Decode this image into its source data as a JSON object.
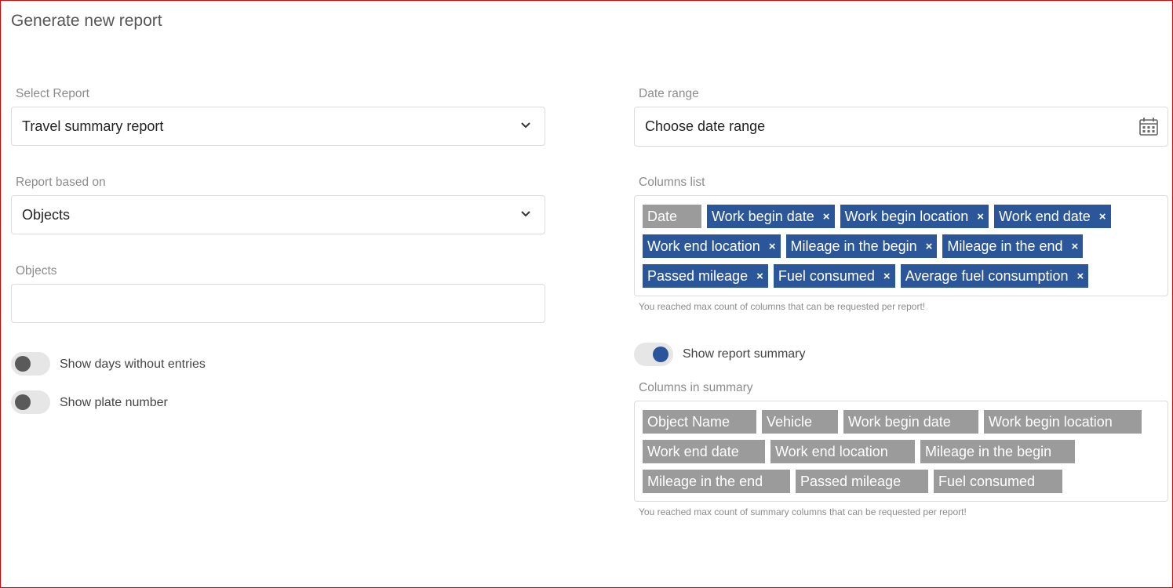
{
  "page_title": "Generate new report",
  "select_report": {
    "label": "Select Report",
    "value": "Travel summary report",
    "icon": "chevron-down-icon"
  },
  "report_based_on": {
    "label": "Report based on",
    "value": "Objects",
    "icon": "chevron-down-icon"
  },
  "objects": {
    "label": "Objects",
    "value": ""
  },
  "toggles": {
    "show_days_without_entries": {
      "label": "Show days without entries",
      "on": false
    },
    "show_plate_number": {
      "label": "Show plate number",
      "on": false
    },
    "show_report_summary": {
      "label": "Show report summary",
      "on": true
    }
  },
  "date_range": {
    "label": "Date range",
    "placeholder": "Choose date range",
    "icon": "calendar-icon"
  },
  "columns_list": {
    "label": "Columns list",
    "tags": [
      {
        "text": "Date",
        "removable": false
      },
      {
        "text": "Work begin date",
        "removable": true
      },
      {
        "text": "Work begin location",
        "removable": true
      },
      {
        "text": "Work end date",
        "removable": true
      },
      {
        "text": "Work end location",
        "removable": true
      },
      {
        "text": "Mileage in the begin",
        "removable": true
      },
      {
        "text": "Mileage in the end",
        "removable": true
      },
      {
        "text": "Passed mileage",
        "removable": true
      },
      {
        "text": "Fuel consumed",
        "removable": true
      },
      {
        "text": "Average fuel consumption",
        "removable": true
      }
    ],
    "remove_glyph": "×",
    "hint": "You reached max count of columns that can be requested per report!"
  },
  "columns_in_summary": {
    "label": "Columns in summary",
    "tags": [
      "Object Name",
      "Vehicle",
      "Work begin date",
      "Work begin location",
      "Work end date",
      "Work end location",
      "Mileage in the begin",
      "Mileage in the end",
      "Passed mileage",
      "Fuel consumed"
    ],
    "hint": "You reached max count of summary columns that can be requested per report!"
  },
  "colors": {
    "accent": "#2b579a",
    "tag_disabled": "#9b9b9b",
    "frame_border": "#e00000"
  }
}
